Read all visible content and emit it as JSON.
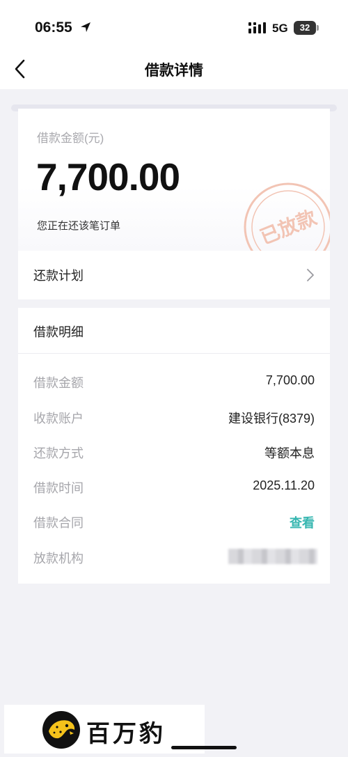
{
  "status": {
    "time": "06:55",
    "network": "5G",
    "battery": "32",
    "icons": [
      "location-arrow-icon",
      "cellular-signal-icon",
      "battery-icon"
    ]
  },
  "nav": {
    "title": "借款详情",
    "back_icon": "chevron-left-icon"
  },
  "amount_card": {
    "label": "借款金额(元)",
    "value": "7,700.00",
    "note": "您正在还该笔订单",
    "stamp": "已放款",
    "stamp_color": "#f2c4b4"
  },
  "repayment_plan": {
    "label": "还款计划",
    "chevron_icon": "chevron-right-icon"
  },
  "details": {
    "title": "借款明细",
    "rows": [
      {
        "label": "借款金额",
        "value": "7,700.00"
      },
      {
        "label": "收款账户",
        "value": "建设银行(8379)"
      },
      {
        "label": "还款方式",
        "value": "等额本息"
      },
      {
        "label": "借款时间",
        "value": "2025.11.20"
      },
      {
        "label": "借款合同",
        "value": "查看"
      },
      {
        "label": "放款机构",
        "value": ""
      }
    ],
    "link_color": "#36b6b0"
  },
  "brand": {
    "name": "百万豹",
    "logo_color": "#f5c21b"
  }
}
